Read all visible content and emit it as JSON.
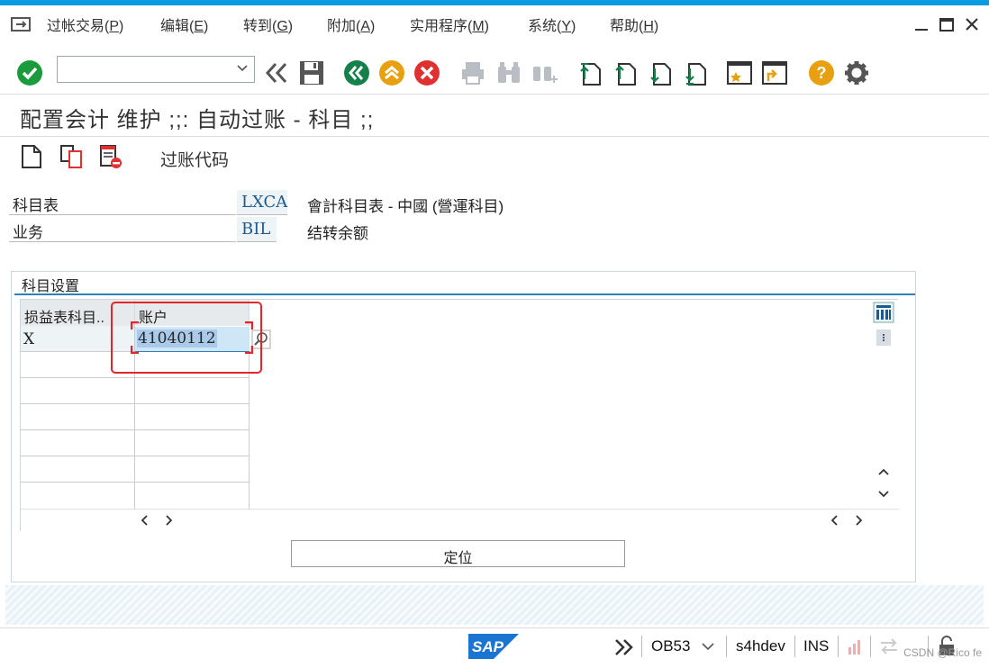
{
  "menubar": {
    "items": [
      {
        "label": "过帐交易(",
        "key": "P",
        "suffix": ")"
      },
      {
        "label": "编辑(",
        "key": "E",
        "suffix": ")"
      },
      {
        "label": "转到(",
        "key": "G",
        "suffix": ")"
      },
      {
        "label": "附加(",
        "key": "A",
        "suffix": ")"
      },
      {
        "label": "实用程序(",
        "key": "M",
        "suffix": ")"
      },
      {
        "label": "系统(",
        "key": "Y",
        "suffix": ")"
      },
      {
        "label": "帮助(",
        "key": "H",
        "suffix": ")"
      }
    ]
  },
  "toolbar": {
    "command_value": "",
    "colors": {
      "green": "#1a9b3c",
      "orange": "#e8a010",
      "red": "#e03030",
      "teal": "#14804a",
      "gray": "#b8bec3"
    }
  },
  "page": {
    "title": "配置会计 维护 ;;: 自动过账 - 科目 ;;"
  },
  "app_toolbar": {
    "posting_code_label": "过账代码"
  },
  "header_fields": [
    {
      "label": "科目表",
      "value": "LXCA",
      "description": "會計科目表 - 中國 (營運科目)"
    },
    {
      "label": "业务",
      "value": "BIL",
      "description": "结转余额"
    }
  ],
  "account_group": {
    "title": "科目设置",
    "columns": [
      "损益表科目..",
      "账户"
    ],
    "rows": [
      {
        "pl_account": "X",
        "account": "41040112"
      }
    ]
  },
  "position_button": {
    "label": "定位"
  },
  "statusbar": {
    "sap_logo": "SAP",
    "transaction": "OB53",
    "system": "s4hdev",
    "mode": "INS",
    "watermark": "CSDN @Rico fe"
  }
}
